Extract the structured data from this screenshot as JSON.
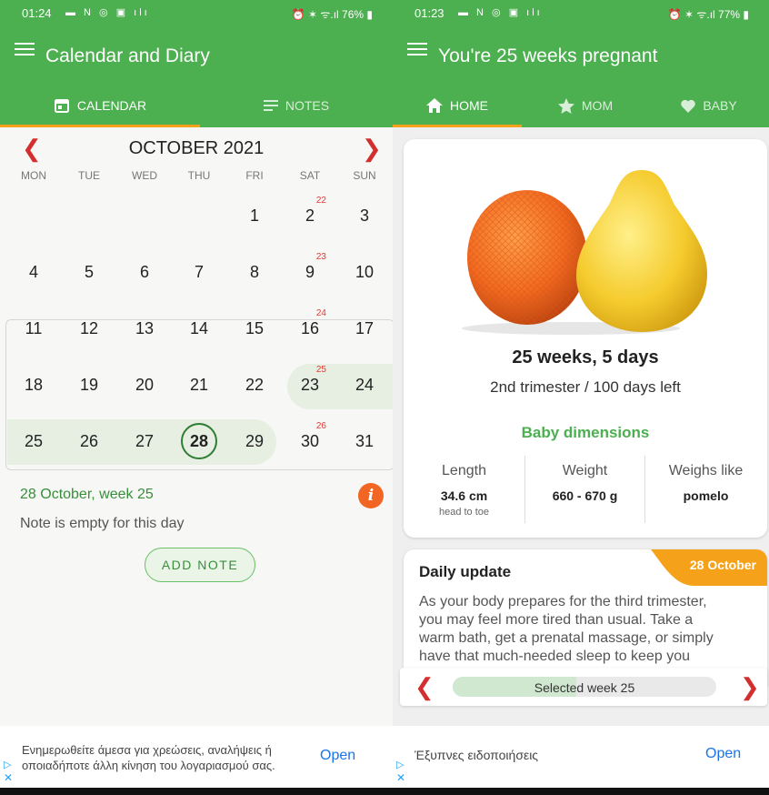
{
  "left": {
    "status": {
      "time": "01:24",
      "right": "76%"
    },
    "title": "Calendar and Diary",
    "tabs": [
      {
        "label": "CALENDAR"
      },
      {
        "label": "NOTES"
      }
    ],
    "month": "OCTOBER 2021",
    "weekdays": [
      "MON",
      "TUE",
      "WED",
      "THU",
      "FRI",
      "SAT",
      "SUN"
    ],
    "weeks": [
      {
        "days": [
          "",
          "",
          "",
          "",
          "1",
          "2",
          "3"
        ],
        "week_no": "22"
      },
      {
        "days": [
          "4",
          "5",
          "6",
          "7",
          "8",
          "9",
          "10"
        ],
        "week_no": "23"
      },
      {
        "days": [
          "11",
          "12",
          "13",
          "14",
          "15",
          "16",
          "17"
        ],
        "week_no": "24"
      },
      {
        "days": [
          "18",
          "19",
          "20",
          "21",
          "22",
          "23",
          "24"
        ],
        "week_no": "25"
      },
      {
        "days": [
          "25",
          "26",
          "27",
          "28",
          "29",
          "30",
          "31"
        ],
        "week_no": "26"
      }
    ],
    "selected_day": "28",
    "note_header": "28 October, week 25",
    "note_empty": "Note is empty for this day",
    "add_note": "ADD NOTE",
    "ad": {
      "text_line1": "Ενημερωθείτε άμεσα για χρεώσεις, αναλήψεις ή",
      "text_line2": "οποιαδήποτε άλλη κίνηση του λογαριασμού σας.",
      "open": "Open"
    }
  },
  "right": {
    "status": {
      "time": "01:23",
      "right": "77%"
    },
    "title": "You're 25 weeks pregnant",
    "tabs": [
      {
        "label": "HOME"
      },
      {
        "label": "MOM"
      },
      {
        "label": "BABY"
      }
    ],
    "weeks_days": "25 weeks, 5 days",
    "trimester": "2nd trimester / 100 days left",
    "baby_dimensions": "Baby dimensions",
    "dims": [
      {
        "label": "Length",
        "value": "34.6 cm",
        "sub": "head to toe"
      },
      {
        "label": "Weight",
        "value": "660 - 670 g",
        "sub": ""
      },
      {
        "label": "Weighs like",
        "value": "pomelo",
        "sub": ""
      }
    ],
    "daily": {
      "title": "Daily update",
      "date": "28 October",
      "lines": [
        "As your body prepares for the third trimester,",
        "you may feel more tired than usual. Take a",
        "warm bath, get a prenatal massage, or simply",
        "have that much-needed sleep to keep you"
      ]
    },
    "selected_week": "Selected week 25",
    "week_progress": 0.47,
    "ad": {
      "text": "Έξυπνες ειδοποιήσεις",
      "open": "Open"
    }
  },
  "colors": {
    "green": "#4caf50",
    "accent": "#f5a21a",
    "red": "#d32f2f",
    "orange": "#f26522"
  }
}
